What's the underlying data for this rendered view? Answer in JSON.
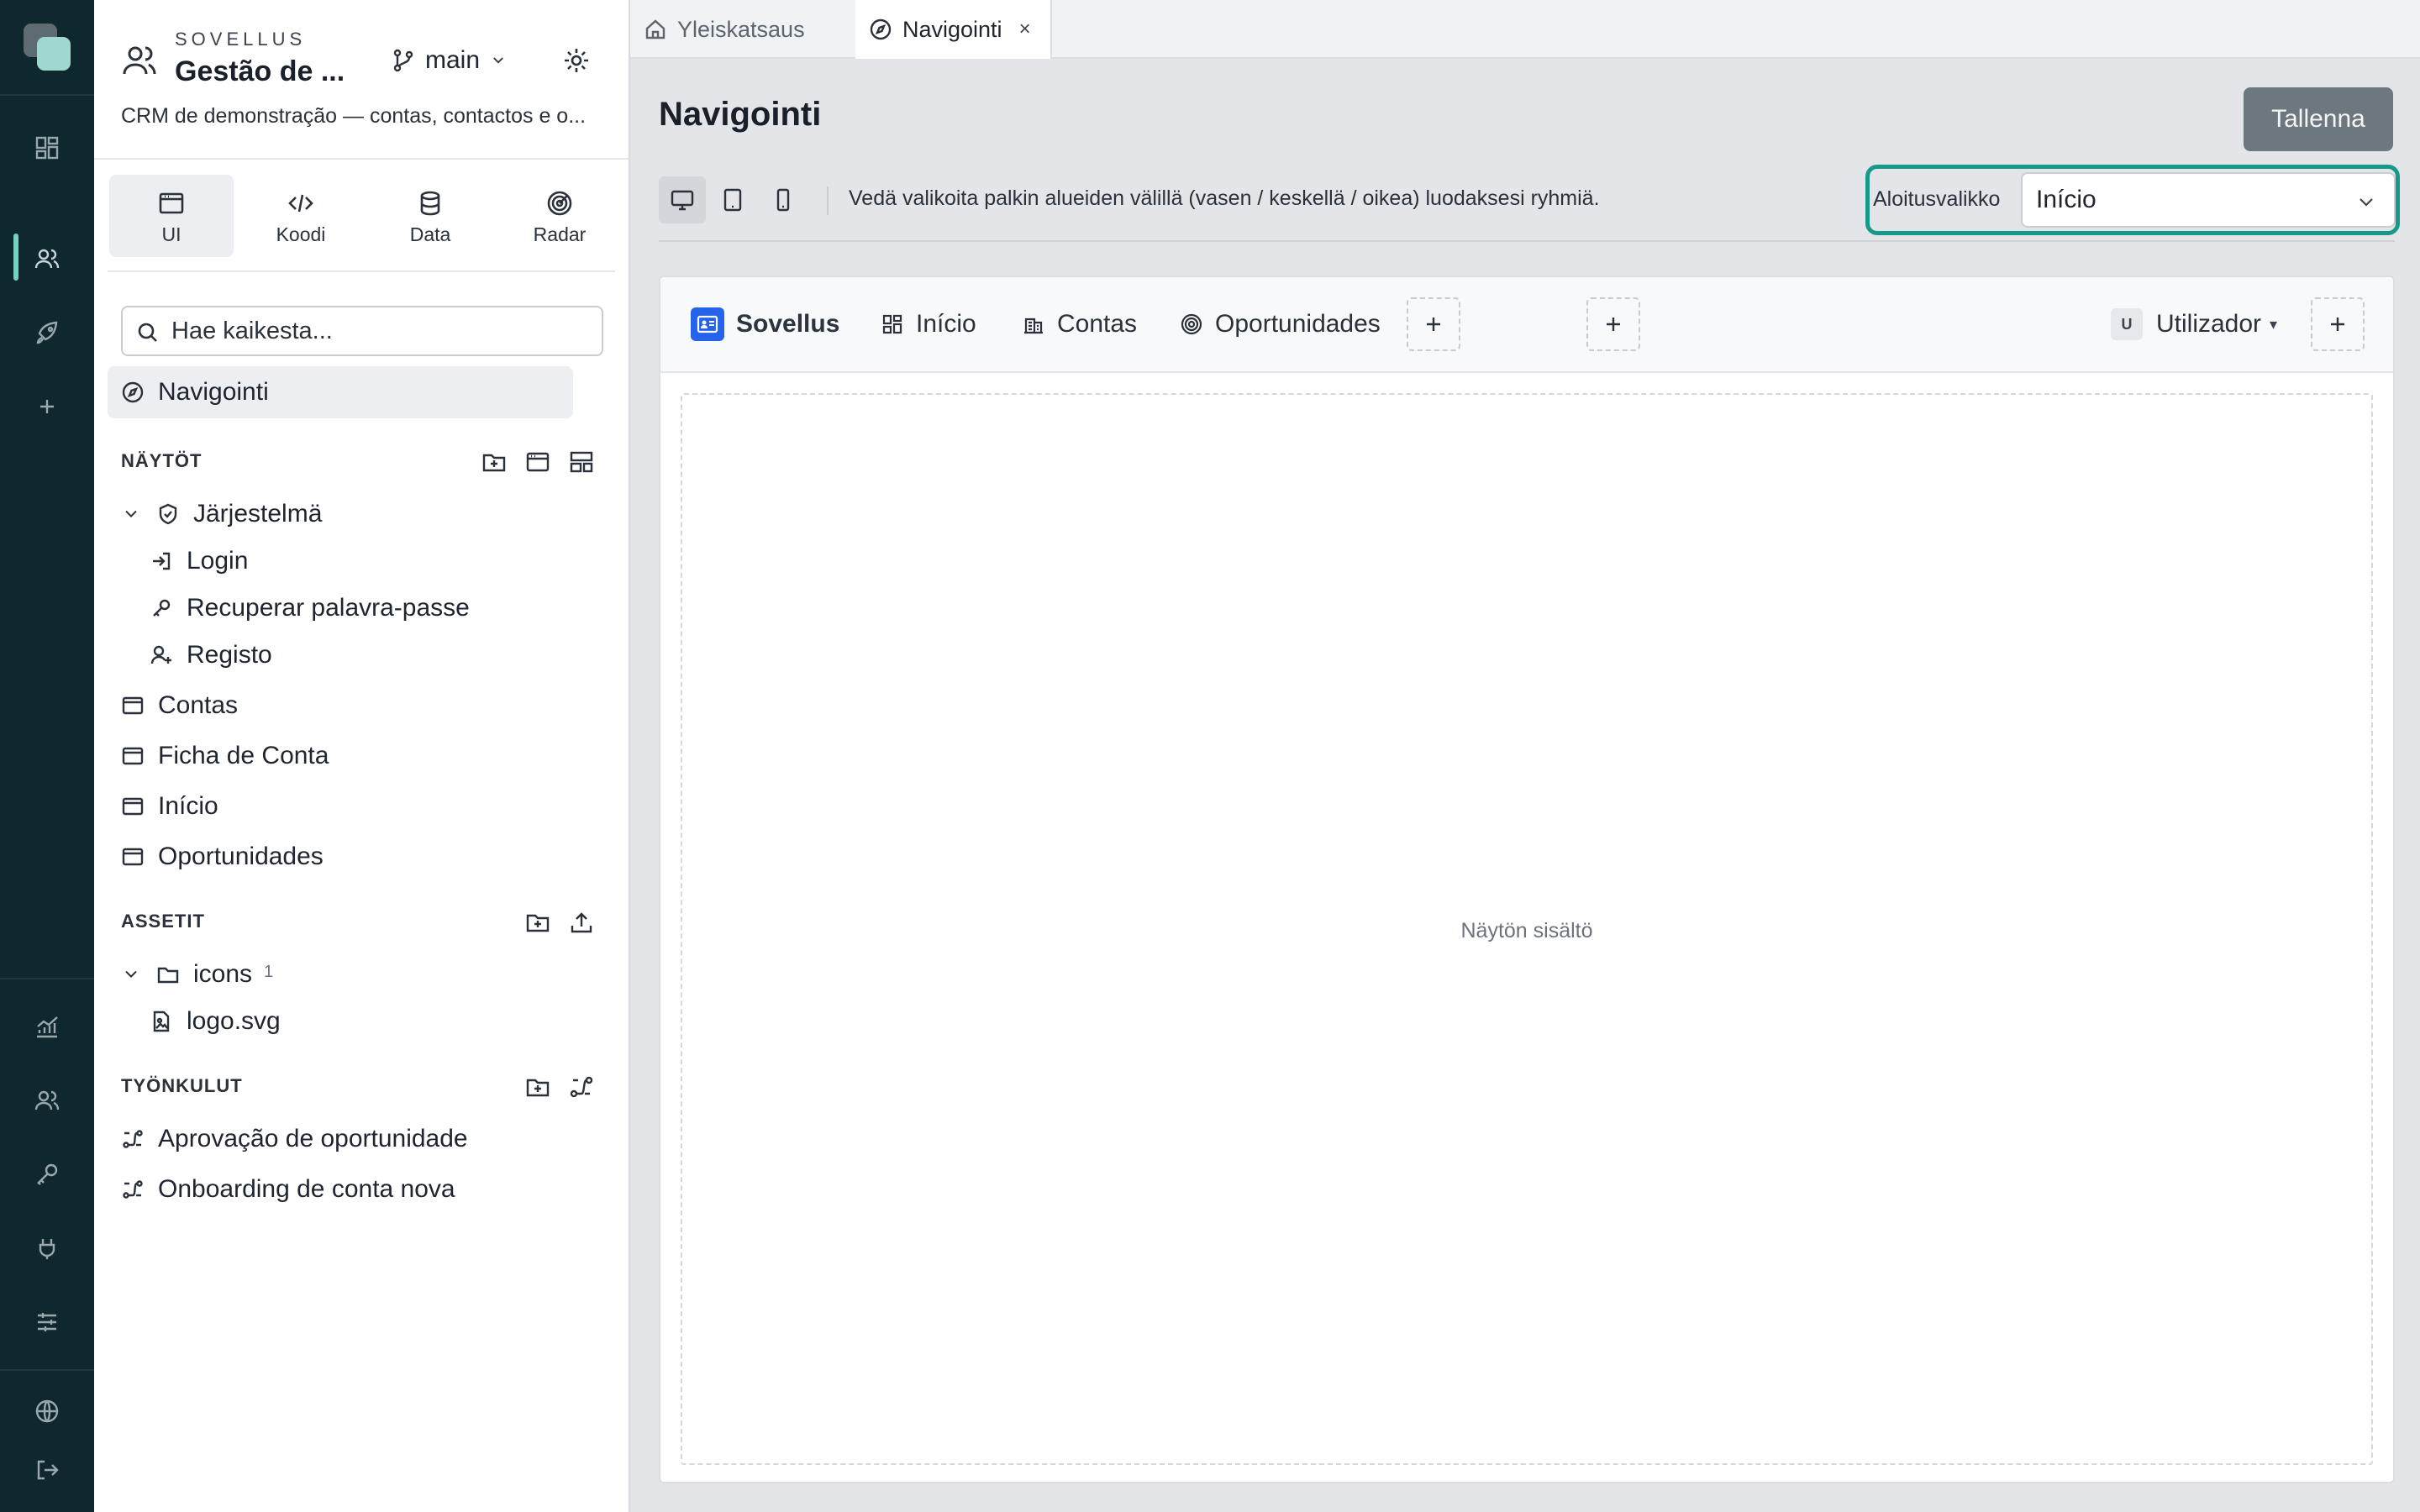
{
  "app": {
    "kicker": "SOVELLUS",
    "name": "Gestão de ...",
    "description": "CRM de demonstração — contas, contactos e o...",
    "branch": "main"
  },
  "modes": [
    {
      "label": "UI",
      "icon": "browser-window-icon",
      "active": true
    },
    {
      "label": "Koodi",
      "icon": "code-icon"
    },
    {
      "label": "Data",
      "icon": "database-icon"
    },
    {
      "label": "Radar",
      "icon": "radar-icon"
    }
  ],
  "search": {
    "placeholder": "Hae kaikesta..."
  },
  "nav_row": {
    "label": "Navigointi"
  },
  "sections": {
    "screens": {
      "title": "NÄYTÖT",
      "group": "Järjestelmä",
      "group_items": [
        "Login",
        "Recuperar palavra-passe",
        "Registo"
      ],
      "items": [
        "Contas",
        "Ficha de Conta",
        "Início",
        "Oportunidades"
      ]
    },
    "assets": {
      "title": "ASSETIT",
      "folder": "icons",
      "folder_count": "1",
      "files": [
        "logo.svg"
      ]
    },
    "workflows": {
      "title": "TYÖNKULUT",
      "items": [
        "Aprovação de oportunidade",
        "Onboarding de conta nova"
      ]
    }
  },
  "tabs": [
    {
      "label": "Yleiskatsaus",
      "icon": "home-icon"
    },
    {
      "label": "Navigointi",
      "icon": "compass-icon",
      "active": true,
      "close": "×"
    }
  ],
  "page": {
    "title": "Navigointi",
    "save_label": "Tallenna"
  },
  "toolbar": {
    "hint": "Vedä valikoita palkin alueiden välillä (vasen / keskellä / oikea) luodaksesi ryhmiä.",
    "start_menu_label": "Aloitusvalikko",
    "start_menu_value": "Início"
  },
  "nav_preview": {
    "brand": "Sovellus",
    "items": [
      {
        "label": "Início",
        "icon": "grid-icon"
      },
      {
        "label": "Contas",
        "icon": "building-icon"
      },
      {
        "label": "Oportunidades",
        "icon": "target-icon"
      }
    ],
    "user_badge": "U",
    "user_label": "Utilizador"
  },
  "screen_placeholder": "Näytön sisältö",
  "colors": {
    "rail_bg": "#0f2830",
    "accent_teal": "#159a8a",
    "brand_blue": "#2563eb",
    "save_button": "#6c777e"
  }
}
